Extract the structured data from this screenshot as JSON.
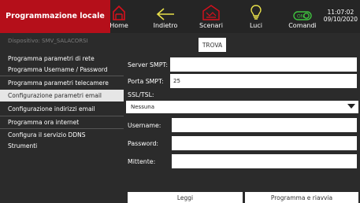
{
  "header": {
    "title": "Programmazione locale",
    "nav": [
      {
        "label": "Home",
        "icon": "home-icon"
      },
      {
        "label": "Indietro",
        "icon": "back-arrow-icon"
      },
      {
        "label": "Scenari",
        "icon": "scenes-icon"
      },
      {
        "label": "Luci",
        "icon": "lightbulb-icon"
      },
      {
        "label": "Comandi",
        "icon": "switch-icon",
        "icon_text": "ON"
      }
    ],
    "time": "11:07:02",
    "date": "09/10/2020"
  },
  "device": {
    "label": "Dispositivo: SMV_SALACORSI",
    "find_button": "TROVA"
  },
  "menu": {
    "items": [
      "Programma parametri di rete",
      "Programma Username / Password",
      "Programma parametri telecamere",
      "Configurazione parametri email",
      "Configurazione indirizzi email",
      "Programma ora internet",
      "Configura il servizio DDNS",
      "Strumenti"
    ],
    "selected_index": 3
  },
  "form": {
    "server_label": "Server SMPT:",
    "server_value": "",
    "port_label": "Porta SMPT:",
    "port_value": "25",
    "ssl_label": "SSL/TSL:",
    "ssl_value": "Nessuna",
    "username_label": "Username:",
    "username_value": "",
    "password_label": "Password:",
    "password_value": "",
    "sender_label": "Mittente:",
    "sender_value": ""
  },
  "actions": {
    "read": "Leggi",
    "program_restart": "Programma e riavvia"
  },
  "colors": {
    "brand_red": "#b50f1a",
    "icon_red": "#d7101c",
    "icon_yellow": "#e8e04a",
    "icon_green": "#3fc23f",
    "background": "#2b2b2b"
  }
}
